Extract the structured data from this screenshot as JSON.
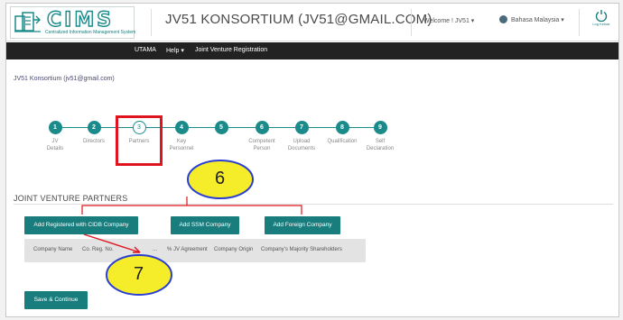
{
  "header": {
    "logo_text": "CIMS",
    "logo_subtitle": "Centralized Information Management System",
    "app_title": "JV51 KONSORTIUM (JV51@GMAIL.COM)",
    "welcome": "Welcome ! JV51 ▾",
    "language": "Bahasa Malaysia ▾",
    "logout_label": "Log Keluar"
  },
  "nav": {
    "items": [
      "UTAMA",
      "Help ▾",
      "Joint Venture Registration"
    ]
  },
  "breadcrumb": "JV51 Konsortium (jv51@gmail.com)",
  "stepper": {
    "current_index": 2,
    "steps": [
      {
        "num": "1",
        "label1": "JV",
        "label2": "Details"
      },
      {
        "num": "2",
        "label1": "Directors",
        "label2": ""
      },
      {
        "num": "3",
        "label1": "Partners",
        "label2": ""
      },
      {
        "num": "4",
        "label1": "Key",
        "label2": "Personnel"
      },
      {
        "num": "5",
        "label1": "",
        "label2": ""
      },
      {
        "num": "6",
        "label1": "Competent",
        "label2": "Person"
      },
      {
        "num": "7",
        "label1": "Upload",
        "label2": "Documents"
      },
      {
        "num": "8",
        "label1": "Qualification",
        "label2": ""
      },
      {
        "num": "9",
        "label1": "Self",
        "label2": "Declaration"
      }
    ]
  },
  "section": {
    "title": "JOINT VENTURE PARTNERS",
    "buttons": {
      "add_cidb": "Add Registered with CIDB Company",
      "add_ssm": "Add SSM Company",
      "add_foreign": "Add Foreign Company"
    },
    "table_headers": [
      "Company Name",
      "Co. Reg. No.",
      "...",
      "% JV Agreement",
      "Company Origin",
      "Company's Majority Shareholders"
    ],
    "save_button": "Save & Continue"
  },
  "annotations": {
    "bubble_6": "6",
    "bubble_7": "7",
    "highlight_color": "#e0141e",
    "bubble_fill": "#f5ec2a",
    "bubble_stroke": "#2a3fd0"
  },
  "colors": {
    "accent": "#1a7d7d",
    "navbar": "#222222"
  }
}
